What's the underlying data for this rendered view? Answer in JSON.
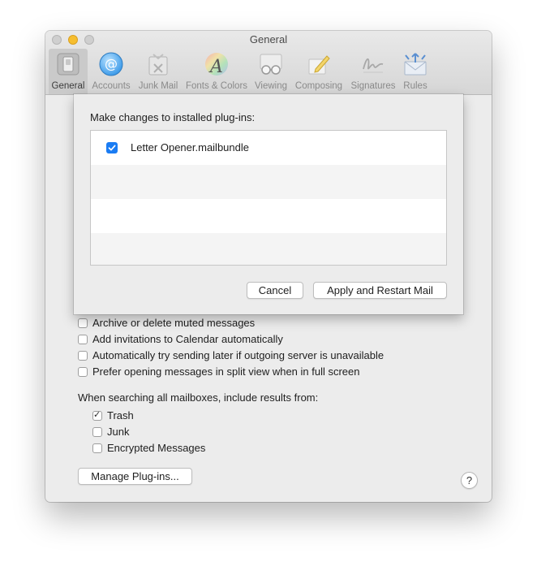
{
  "window": {
    "title": "General"
  },
  "toolbar": {
    "items": [
      {
        "label": "General",
        "icon": "general-switch-icon",
        "active": true
      },
      {
        "label": "Accounts",
        "icon": "at-sign-icon"
      },
      {
        "label": "Junk Mail",
        "icon": "junk-trash-icon"
      },
      {
        "label": "Fonts & Colors",
        "icon": "font-color-wheel-icon"
      },
      {
        "label": "Viewing",
        "icon": "glasses-icon"
      },
      {
        "label": "Composing",
        "icon": "pencil-paper-icon"
      },
      {
        "label": "Signatures",
        "icon": "signature-icon"
      },
      {
        "label": "Rules",
        "icon": "envelope-arrows-icon"
      }
    ]
  },
  "sheet": {
    "title": "Make changes to installed plug-ins:",
    "plugins": [
      {
        "name": "Letter Opener.mailbundle",
        "checked": true
      }
    ],
    "cancel_label": "Cancel",
    "apply_label": "Apply and Restart Mail",
    "accent": "#1a7cf3"
  },
  "options": [
    {
      "label": "Archive or delete muted messages",
      "checked": false
    },
    {
      "label": "Add invitations to Calendar automatically",
      "checked": false
    },
    {
      "label": "Automatically try sending later if outgoing server is unavailable",
      "checked": false
    },
    {
      "label": "Prefer opening messages in split view when in full screen",
      "checked": false
    }
  ],
  "search": {
    "label": "When searching all mailboxes, include results from:",
    "items": [
      {
        "label": "Trash",
        "checked": true
      },
      {
        "label": "Junk",
        "checked": false
      },
      {
        "label": "Encrypted Messages",
        "checked": false
      }
    ]
  },
  "manage_plugins_label": "Manage Plug-ins...",
  "help_label": "?",
  "check_glyph": "✓"
}
